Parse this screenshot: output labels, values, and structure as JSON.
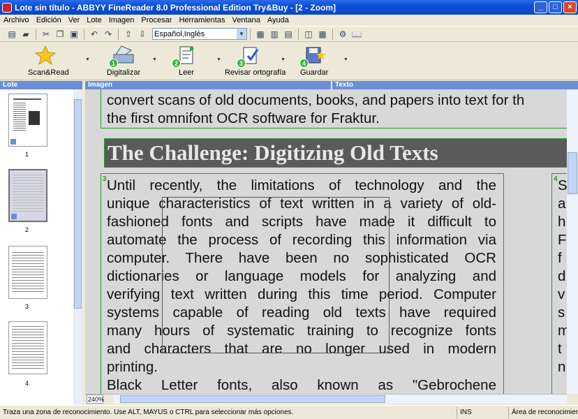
{
  "window": {
    "title": "Lote sin título - ABBYY FineReader 8.0 Professional Edition Try&Buy - [2 - Zoom]",
    "min": "_",
    "max": "□",
    "close": "×"
  },
  "menu": [
    "Archivo",
    "Edición",
    "Ver",
    "Lote",
    "Imagen",
    "Procesar",
    "Herramientas",
    "Ventana",
    "Ayuda"
  ],
  "toolbar": {
    "language": "Español,Inglés"
  },
  "big_buttons": [
    {
      "label": "Scan&Read",
      "num": ""
    },
    {
      "label": "Digitalizar",
      "num": "1"
    },
    {
      "label": "Leer",
      "num": "2"
    },
    {
      "label": "Revisar ortografía",
      "num": "3"
    },
    {
      "label": "Guardar",
      "num": "4"
    }
  ],
  "panes": {
    "lote": "Lote",
    "imagen": "Imagen",
    "texto": "Texto"
  },
  "pages": [
    "1",
    "2",
    "3",
    "4"
  ],
  "document": {
    "block_top_lines": [
      "convert scans of old documents, books, and papers into text for th",
      "the first omnifont OCR software for Fraktur."
    ],
    "heading": "The Challenge: Digitizing Old Texts",
    "block3_num": "3",
    "block3_lines": [
      "Until recently, the limitations of technology and the",
      "unique characteristics of text written in a variety of old-",
      "fashioned fonts and scripts have made it difficult to",
      "automate the process of recording this information via",
      "computer. There have been no sophisticated OCR",
      "dictionaries or language models for analyzing and",
      "verifying text written during this time period. Computer",
      "systems capable of reading old texts have required",
      "many hours of systematic training to recognize fonts",
      "and characters that are no longer used in modern",
      "printing.",
      "Black Letter fonts, also known as \"Gebrochene"
    ],
    "block4_num": "4",
    "block4_letters": [
      "S",
      "a",
      "h",
      "F",
      "f",
      "d",
      "v",
      "s",
      "m",
      "t",
      "n"
    ]
  },
  "zoom": "240%",
  "status": {
    "message": "Traza una zona de reconocimiento. Use ALT, MAYÚS o CTRL para seleccionar más opciones.",
    "ins": "INS",
    "area": "Área de reconocimiento"
  }
}
